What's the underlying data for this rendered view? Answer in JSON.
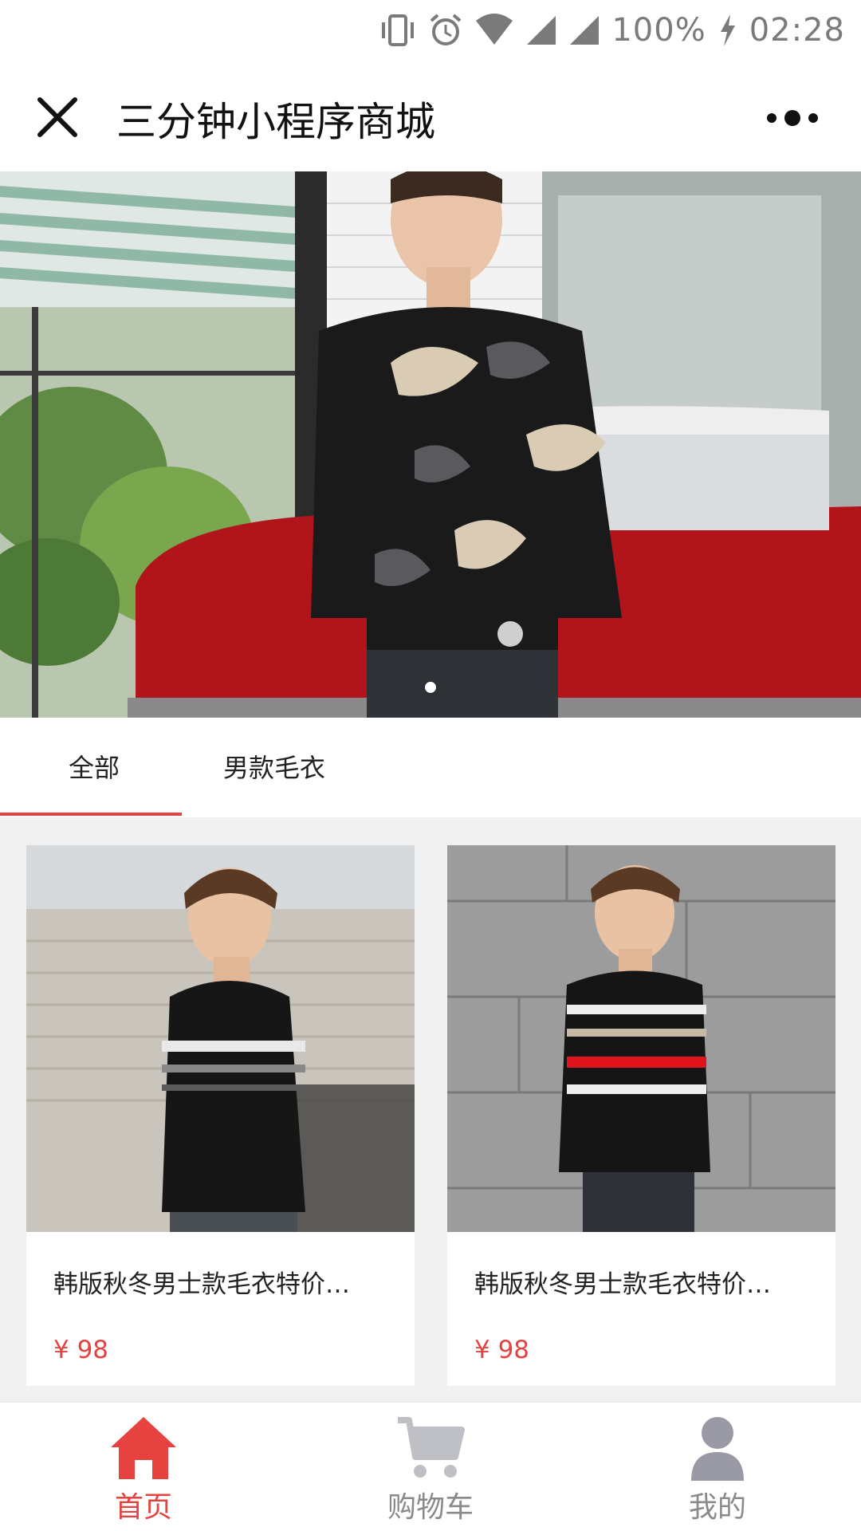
{
  "status_bar": {
    "battery": "100%",
    "time": "02:28"
  },
  "nav": {
    "title": "三分钟小程序商城"
  },
  "category_tabs": [
    {
      "label": "全部",
      "active": true
    },
    {
      "label": "男款毛衣",
      "active": false
    }
  ],
  "products": [
    {
      "title": "韩版秋冬男士款毛衣特价…",
      "price": "¥ 98"
    },
    {
      "title": "韩版秋冬男士款毛衣特价…",
      "price": "¥ 98"
    }
  ],
  "tab_bar": {
    "items": [
      {
        "label": "首页",
        "icon": "home-icon",
        "active": true
      },
      {
        "label": "购物车",
        "icon": "cart-icon",
        "active": false
      },
      {
        "label": "我的",
        "icon": "user-icon",
        "active": false
      }
    ]
  },
  "colors": {
    "accent": "#e64340",
    "inactive": "#8a8a8a"
  }
}
